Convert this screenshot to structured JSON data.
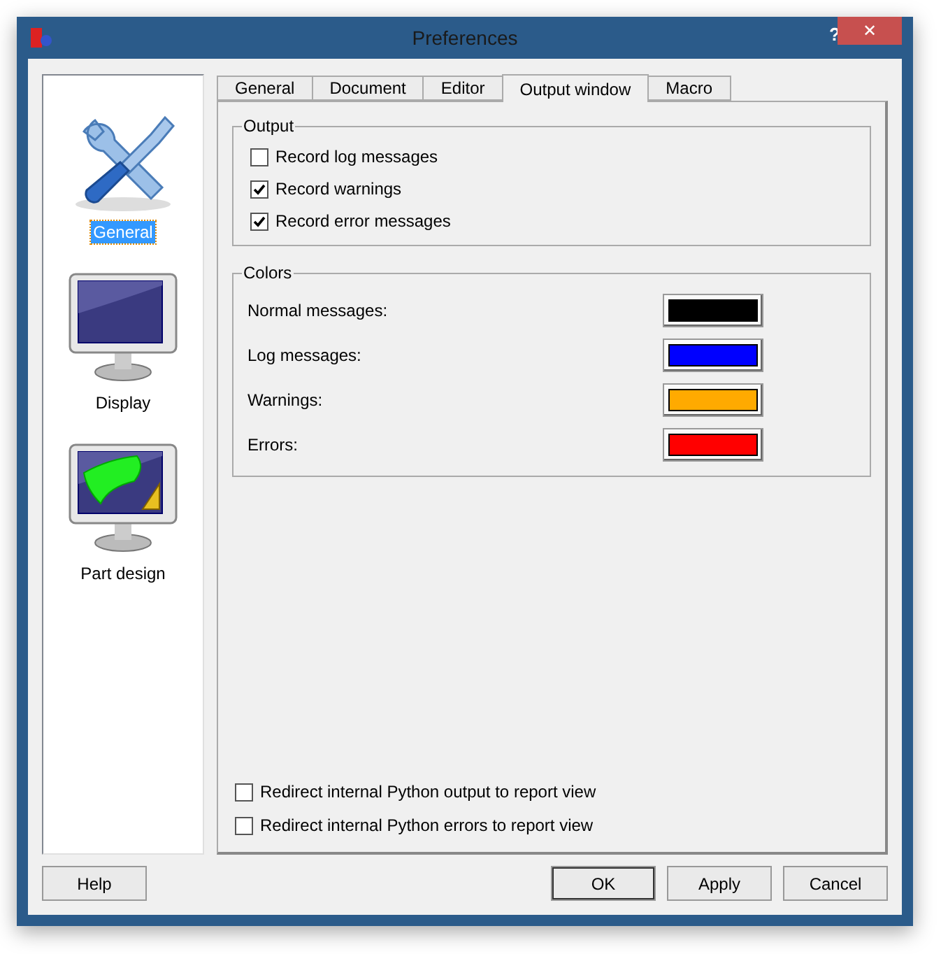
{
  "window": {
    "title": "Preferences",
    "help": "?",
    "close": "✕"
  },
  "sidebar": {
    "items": [
      {
        "label": "General",
        "kind": "tools",
        "selected": true
      },
      {
        "label": "Display",
        "kind": "monitor",
        "selected": false
      },
      {
        "label": "Part design",
        "kind": "design",
        "selected": false
      }
    ]
  },
  "tabs": [
    {
      "label": "General",
      "selected": false
    },
    {
      "label": "Document",
      "selected": false
    },
    {
      "label": "Editor",
      "selected": false
    },
    {
      "label": "Output window",
      "selected": true
    },
    {
      "label": "Macro",
      "selected": false
    }
  ],
  "output": {
    "title": "Output",
    "options": [
      {
        "label": "Record log messages",
        "checked": false
      },
      {
        "label": "Record warnings",
        "checked": true
      },
      {
        "label": "Record error messages",
        "checked": true
      }
    ]
  },
  "colors": {
    "title": "Colors",
    "items": [
      {
        "label": "Normal messages:",
        "color": "#000000"
      },
      {
        "label": "Log messages:",
        "color": "#0000ff"
      },
      {
        "label": "Warnings:",
        "color": "#ffaa00"
      },
      {
        "label": "Errors:",
        "color": "#ff0000"
      }
    ]
  },
  "redirect": [
    {
      "label": "Redirect internal Python output to report view",
      "checked": false
    },
    {
      "label": "Redirect internal Python errors to report view",
      "checked": false
    }
  ],
  "buttons": {
    "help": "Help",
    "actions": [
      "OK",
      "Apply",
      "Cancel"
    ]
  }
}
